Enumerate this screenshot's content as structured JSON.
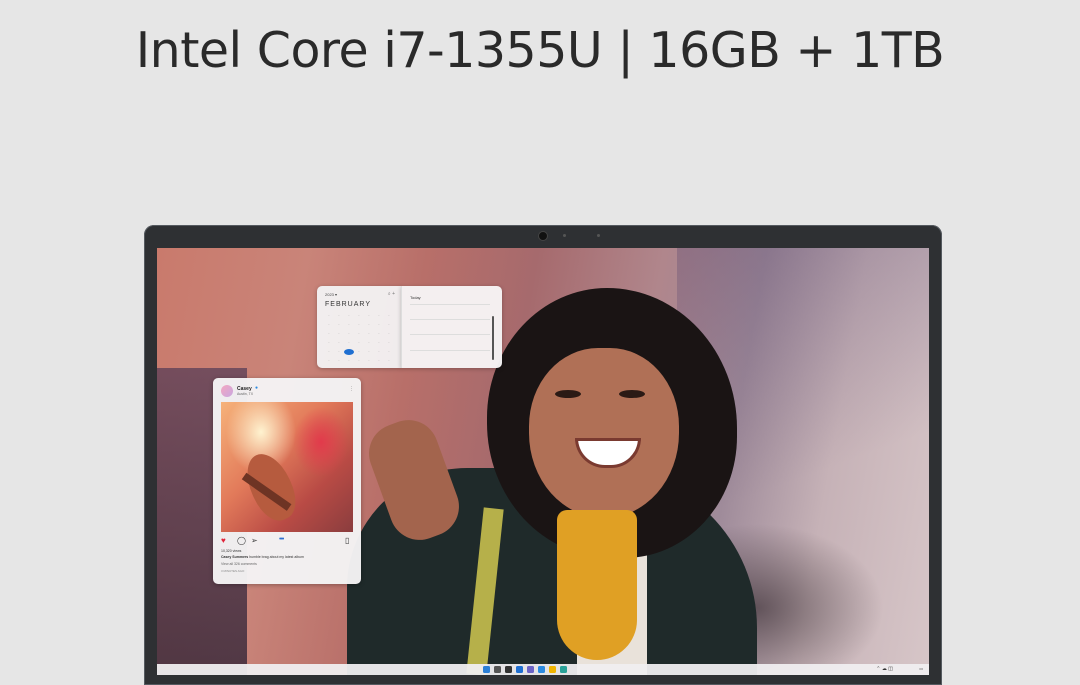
{
  "headline": "Intel Core i7-1355U | 16GB + 1TB",
  "calendar": {
    "year_label": "2023 ▾",
    "month": "FEBRUARY",
    "toolbar_icons": [
      "search-icon",
      "add-icon"
    ],
    "weekdays": [
      "",
      "",
      "",
      "",
      "",
      "",
      ""
    ],
    "days": [
      "",
      "",
      "",
      "",
      "",
      "",
      "",
      "",
      "",
      "",
      "",
      "",
      "",
      "",
      "",
      "",
      "",
      "",
      "",
      "",
      "",
      "",
      "",
      "",
      "",
      "",
      "",
      "",
      "",
      "",
      "",
      "",
      "",
      "",
      ""
    ],
    "selected_index": 23
  },
  "agenda": {
    "title": "Today"
  },
  "post": {
    "username": "Casey",
    "location": "Austin, TX",
    "views": "10,320 views",
    "caption_user": "Casey Summers",
    "caption_text": "humble brag about my latest album",
    "comments": "View all 326 comments",
    "time_ago": "3 MINUTES AGO"
  },
  "taskbar": {
    "icon_colors": [
      "#2b7fd6",
      "#555555",
      "#333333",
      "#1f6fd1",
      "#6b63c6",
      "#2b8ae0",
      "#f0b400",
      "#2aa198"
    ]
  },
  "colors": {
    "background": "#e6e6e6",
    "bezel": "#2e3033",
    "calendar_selected": "#1f6fd1",
    "heart": "#e0243a"
  }
}
